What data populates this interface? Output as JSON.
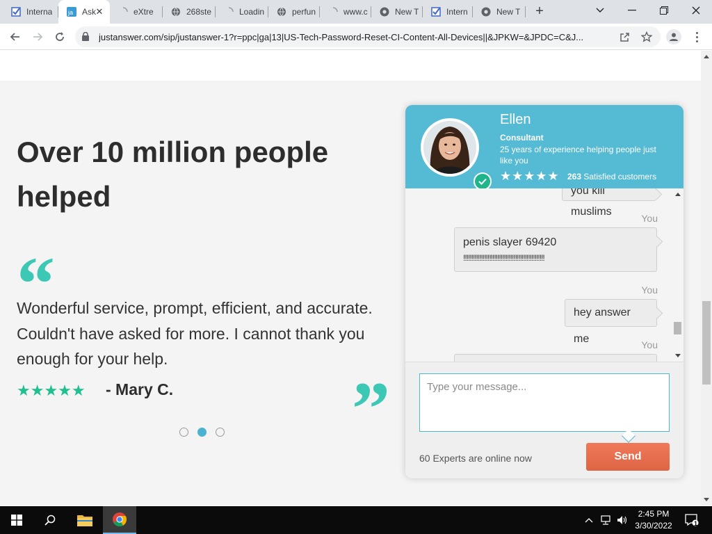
{
  "browser": {
    "tabs": [
      {
        "label": "Interna",
        "icon": "check-square-icon"
      },
      {
        "label": "Ask",
        "icon": "justanswer-icon",
        "active": true
      },
      {
        "label": "eXtre",
        "icon": "loading-spinner-icon"
      },
      {
        "label": "268ste",
        "icon": "globe-icon"
      },
      {
        "label": "Loadin",
        "icon": "loading-spinner-icon"
      },
      {
        "label": "perfun",
        "icon": "globe-icon"
      },
      {
        "label": "www.c",
        "icon": "loading-spinner-icon"
      },
      {
        "label": "New T",
        "icon": "chrome-icon"
      },
      {
        "label": "Intern",
        "icon": "check-square-icon"
      },
      {
        "label": "New T",
        "icon": "chrome-icon"
      }
    ],
    "url": "justanswer.com/sip/justanswer-1?r=ppc|ga|13|US-Tech-Password-Reset-CI-Content-All-Devices||&JPKW=&JPDC=C&J..."
  },
  "page": {
    "headline": "Over 10 million people helped",
    "quote_open": "“",
    "quote_text": "Wonderful service, prompt, efficient, and accurate. Couldn't have asked for more. I cannot thank you enough for your help.",
    "rating_stars": "★★★★★",
    "author": "- Mary C.",
    "quote_close": "”",
    "carousel_active_index": 1
  },
  "chat": {
    "expert_name": "Ellen",
    "expert_title": "Consultant",
    "expert_desc": "25 years of experience helping people just like you",
    "expert_stars": "★★★★★",
    "satisfied_count": "263",
    "satisfied_label": "Satisfied customers",
    "messages": [
      {
        "sender": "",
        "line1": "you kill muslims",
        "line2": ""
      },
      {
        "sender": "You",
        "line1": "penis slayer 69420",
        "line2": "!!!!!!!!!!!!!!!!!!!!!!!!!!!!!!!!!!!!!!!!!!!!!!!!!!"
      },
      {
        "sender": "You",
        "line1": "hey answer me",
        "line2": ""
      },
      {
        "sender": "You",
        "line1": "",
        "line2": ""
      }
    ],
    "input_placeholder": "Type your message...",
    "online_text": "60 Experts are online now",
    "send_label": "Send"
  },
  "taskbar": {
    "time": "2:45 PM",
    "date": "3/30/2022",
    "notification_count": "1"
  },
  "colors": {
    "accent_teal": "#3cc8b4",
    "chat_header": "#55bad4",
    "send_button": "#e36c4c",
    "stars_green": "#1fbf8f"
  }
}
